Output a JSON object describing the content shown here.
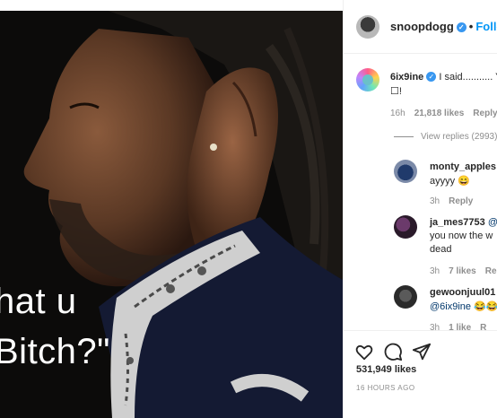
{
  "post": {
    "caption_line1": "hat u",
    "caption_line2": "Bitch?\""
  },
  "header": {
    "username": "snoopdogg",
    "separator": "•",
    "follow_label": "Follow",
    "verified_icon": "verified-badge-icon"
  },
  "comments": [
    {
      "username": "6ix9ine",
      "verified": true,
      "text_line1": "I said........... Y",
      "text_line2": "☐!",
      "time": "16h",
      "likes": "21,818 likes",
      "reply_label": "Reply",
      "view_replies": "View replies (2993)"
    },
    {
      "username": "monty_apples",
      "text": "ayyyy 😄",
      "time": "3h",
      "reply_label": "Reply"
    },
    {
      "username": "ja_mes7753",
      "text_line1": "@",
      "text_line2": "you now the w",
      "text_line3": "dead",
      "time": "3h",
      "likes": "7 likes",
      "reply_label": "Repl"
    },
    {
      "username": "gewoonjuul01",
      "text_line1": "@6ix9ine 😂😂",
      "time": "3h",
      "likes": "1 like",
      "reply_label": "R"
    }
  ],
  "actions": {
    "like_icon": "heart-icon",
    "comment_icon": "comment-icon",
    "share_icon": "share-icon",
    "likes_count": "531,949 likes",
    "timestamp": "16 HOURS AGO"
  },
  "colors": {
    "accent": "#0095f6",
    "verified": "#3897f0",
    "muted": "#8e8e8e",
    "text": "#262626"
  }
}
